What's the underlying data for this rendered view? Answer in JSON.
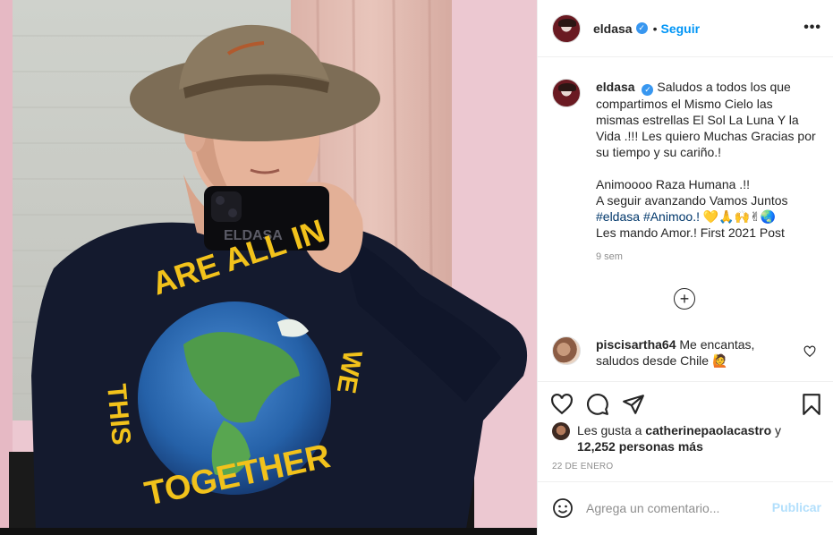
{
  "post": {
    "username": "eldasa",
    "follow_label": "Seguir",
    "more_label": "•••"
  },
  "caption": {
    "username": "eldasa",
    "line1": "Saludos a todos los que",
    "line2": "compartimos el Mismo Cielo las",
    "line3": "mismas estrellas El Sol La Luna Y la",
    "line4": "Vida .!!! Les quiero Muchas Gracias por",
    "line5": "su tiempo y su cariño.!",
    "line6": "Animoooo Raza Humana .!!",
    "line7": "A seguir avanzando Vamos Juntos",
    "tag1": "#eldasa",
    "tag2": "#Animoo.!",
    "emojis": "💛🙏🙌✌🌏",
    "line9": "Les mando Amor.! First 2021 Post",
    "time": "9 sem"
  },
  "load_more_label": "+",
  "comment": {
    "username": "piscisartha64",
    "text_part1": "Me encantas,",
    "text_part2": "saludos desde Chile 🙋"
  },
  "likes": {
    "prefix": "Les gusta a",
    "user": "catherinepaolacastro",
    "connector": "y",
    "count": "12,252 personas más"
  },
  "date": "22 DE ENERO",
  "add_comment": {
    "placeholder": "Agrega un comentario...",
    "publish_label": "Publicar"
  },
  "photo": {
    "phone_case_text": "ELDASA",
    "shirt_text_top": "ARE ALL IN",
    "shirt_text_left": "THIS",
    "shirt_text_bottom": "TOGETHER",
    "shirt_text_right": "WE"
  },
  "colors": {
    "accent": "#0095f6",
    "verified": "#3897f0",
    "publish_disabled": "#b2dffc",
    "hashtag": "#00376b",
    "muted": "#8e8e8e",
    "shirt": "#141a2e",
    "shirt_print": "#f2c21b"
  }
}
